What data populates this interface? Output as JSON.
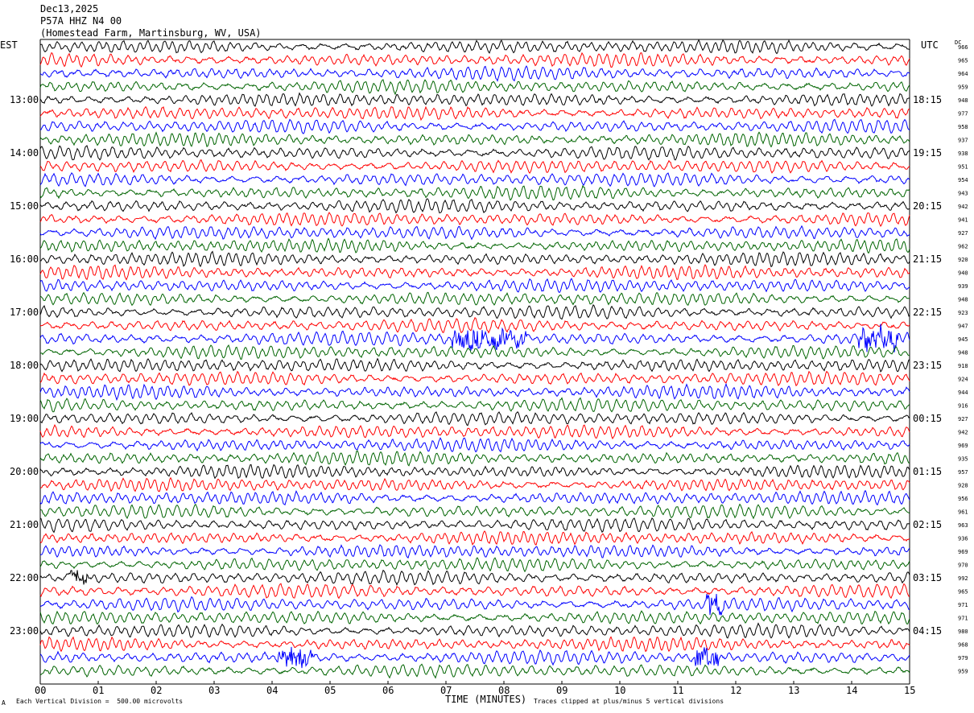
{
  "header": {
    "date": "Dec13,2025",
    "station": "P57A HHZ N4 00",
    "location": "(Homestead Farm, Martinsburg, WV, USA)"
  },
  "left_zone_label": "EST",
  "right_zone_label": "UTC",
  "dc_label": "DC",
  "footer": {
    "mark": "A",
    "scale_note": "Each Vertical Division =  500.00 microvolts",
    "clip_note": "Traces clipped at plus/minus 5 vertical divisions"
  },
  "colors": {
    "trace_cycle": [
      "#000000",
      "#ff0000",
      "#0000ff",
      "#006400"
    ]
  },
  "chart_data": {
    "type": "line",
    "subtype": "helicorder",
    "xlabel": "TIME (MINUTES)",
    "xlim": [
      0,
      15
    ],
    "x_ticks": [
      "00",
      "01",
      "02",
      "03",
      "04",
      "05",
      "06",
      "07",
      "08",
      "09",
      "10",
      "11",
      "12",
      "13",
      "14",
      "15"
    ],
    "left_hour_labels": [
      "13:00",
      "14:00",
      "15:00",
      "16:00",
      "17:00",
      "18:00",
      "19:00",
      "20:00",
      "21:00",
      "22:00",
      "23:00"
    ],
    "right_hour_labels": [
      "18:15",
      "19:15",
      "20:15",
      "21:15",
      "22:15",
      "23:15",
      "00:15",
      "01:15",
      "02:15",
      "03:15",
      "04:15"
    ],
    "trace_dc_values": [
      "966",
      "965",
      "964",
      "959",
      "948",
      "977",
      "958",
      "937",
      "938",
      "951",
      "954",
      "943",
      "942",
      "941",
      "927",
      "962",
      "920",
      "940",
      "939",
      "948",
      "923",
      "947",
      "945",
      "948",
      "918",
      "924",
      "944",
      "916",
      "927",
      "942",
      "969",
      "935",
      "957",
      "928",
      "956",
      "961",
      "963",
      "936",
      "969",
      "970",
      "992",
      "965",
      "971",
      "971",
      "980",
      "968",
      "979",
      "959"
    ],
    "notable_events": [
      {
        "trace": 22,
        "minutes": [
          7.1,
          8.4
        ],
        "desc": "burst"
      },
      {
        "trace": 22,
        "minutes": [
          14.1,
          14.8
        ],
        "desc": "burst"
      },
      {
        "trace": 40,
        "minutes": [
          0.5,
          0.8
        ],
        "desc": "burst"
      },
      {
        "trace": 42,
        "minutes": [
          11.5,
          11.8
        ],
        "desc": "spike"
      },
      {
        "trace": 46,
        "minutes": [
          4.1,
          4.7
        ],
        "desc": "burst"
      },
      {
        "trace": 46,
        "minutes": [
          11.3,
          11.7
        ],
        "desc": "burst"
      }
    ]
  }
}
